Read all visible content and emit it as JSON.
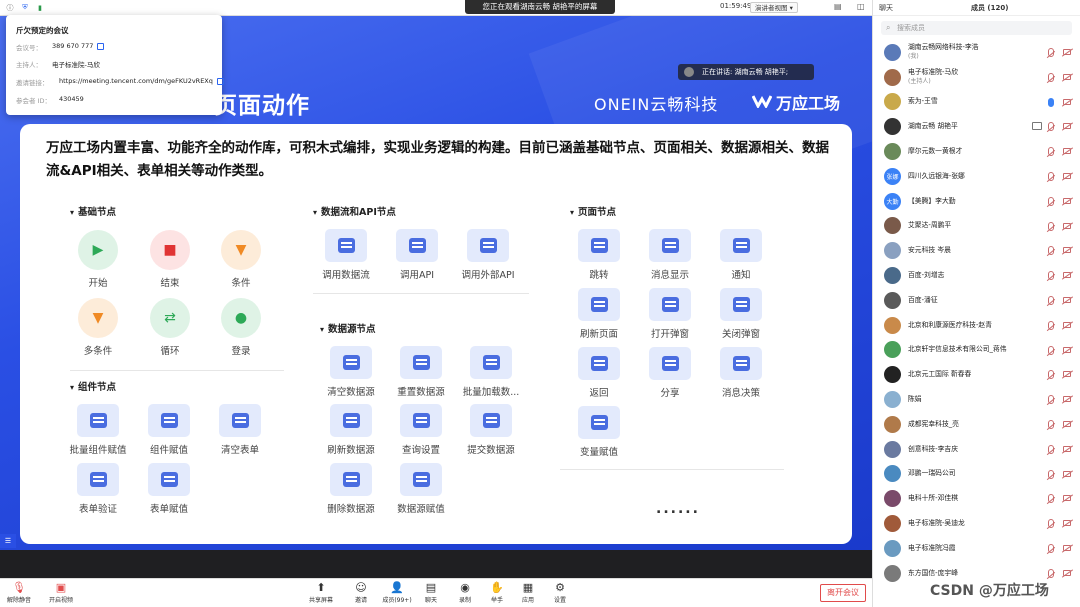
{
  "window": {
    "share_banner": "您正在观看湖南云畅 胡艳平的屏幕",
    "timer": "01:59:49",
    "view_mode": "演讲者视图 ▾"
  },
  "popup": {
    "title": "斤欠预定的会议",
    "rows": [
      {
        "label": "会议号：",
        "value": "389 670 777",
        "copy": true
      },
      {
        "label": "主持人：",
        "value": "电子标准院-马欣",
        "copy": false
      },
      {
        "label": "邀请链接：",
        "value": "https://meeting.tencent.com/dm/geFKU2vREXq",
        "copy": true
      },
      {
        "label": "参会者 ID：",
        "value": "430459",
        "copy": false
      }
    ]
  },
  "slide": {
    "speaker": "正在讲话: 湖南云畅 胡艳平;",
    "title": "页面动作",
    "brand_left": "ONEIN云畅科技",
    "brand_right": "万应工场",
    "intro": "万应工场内置丰富、功能齐全的动作库，可积木式编排，实现业务逻辑的构建。目前已涵盖基础节点、页面相关、数据源相关、数据流&API相关、表单相关等动作类型。",
    "sections": {
      "basic": "基础节点",
      "component": "组件节点",
      "dataflow": "数据流和API节点",
      "datasource": "数据源节点",
      "page": "页面节点"
    },
    "basic_nodes": [
      "开始",
      "结束",
      "条件",
      "多条件",
      "循环",
      "登录"
    ],
    "component_nodes": [
      "批量组件赋值",
      "组件赋值",
      "清空表单",
      "表单验证",
      "表单赋值"
    ],
    "dataflow_nodes": [
      "调用数据流",
      "调用API",
      "调用外部API"
    ],
    "datasource_nodes": [
      "清空数据源",
      "重置数据源",
      "批量加载数...",
      "刷新数据源",
      "查询设置",
      "提交数据源",
      "删除数据源",
      "数据源赋值"
    ],
    "page_nodes": [
      "跳转",
      "消息显示",
      "通知",
      "刷新页面",
      "打开弹窗",
      "关闭弹窗",
      "返回",
      "分享",
      "消息决策",
      "变量赋值"
    ],
    "more": "......"
  },
  "toolbar": {
    "mute": "解除静音",
    "video": "开启视频",
    "share": "共享屏幕",
    "invite": "邀请",
    "members": "成员(99+)",
    "chat": "聊天",
    "record": "录制",
    "raise": "举手",
    "apps": "应用",
    "settings": "设置",
    "leave": "离开会议"
  },
  "right_panel": {
    "tab_chat": "聊天",
    "tab_members": "成员 (120)",
    "search_placeholder": "搜索成员",
    "members": [
      {
        "name": "湖南云畅网络科技-李浩",
        "sub": "(我)",
        "color": "#5a7ab8",
        "text": ""
      },
      {
        "name": "电子标准院-马欣",
        "sub": "(主持人)",
        "color": "#a06a4a",
        "text": ""
      },
      {
        "name": "索为-王雪",
        "sub": "",
        "color": "#c9a94a",
        "text": "",
        "mic_on": true
      },
      {
        "name": "湖南云畅 胡艳平",
        "sub": "",
        "color": "#333333",
        "text": "",
        "screen": true
      },
      {
        "name": "摩尔元数一黄根才",
        "sub": "",
        "color": "#6a8a5a",
        "text": ""
      },
      {
        "name": "四川久远银海-张娜",
        "sub": "",
        "color": "#3b82f6",
        "text": "张娜"
      },
      {
        "name": "【美腾】李大勤",
        "sub": "",
        "color": "#3b82f6",
        "text": "大勤"
      },
      {
        "name": "艾聚达-周鹏平",
        "sub": "",
        "color": "#7a5a4a",
        "text": ""
      },
      {
        "name": "安元科技 岑晨",
        "sub": "",
        "color": "#8aa0c0",
        "text": ""
      },
      {
        "name": "百度-刘增志",
        "sub": "",
        "color": "#4a6a8a",
        "text": ""
      },
      {
        "name": "百度-潘征",
        "sub": "",
        "color": "#5a5a5a",
        "text": ""
      },
      {
        "name": "北京和利康源医疗科技-赵青",
        "sub": "",
        "color": "#c98a4a",
        "text": ""
      },
      {
        "name": "北京轩宇信息技术有限公司_蒋伟",
        "sub": "",
        "color": "#4aa05a",
        "text": ""
      },
      {
        "name": "北京元工国际 靳春春",
        "sub": "",
        "color": "#222222",
        "text": ""
      },
      {
        "name": "陈娟",
        "sub": "",
        "color": "#8ab0d0",
        "text": ""
      },
      {
        "name": "成都宪幸科技_亮",
        "sub": "",
        "color": "#b07a4a",
        "text": ""
      },
      {
        "name": "创意科技-李吉庆",
        "sub": "",
        "color": "#6a7aa0",
        "text": ""
      },
      {
        "name": "邓鹏一瑞码公司",
        "sub": "",
        "color": "#4a8ac0",
        "text": ""
      },
      {
        "name": "电科十所-邓佳棋",
        "sub": "",
        "color": "#7a4a6a",
        "text": ""
      },
      {
        "name": "电子标准院-吴迪龙",
        "sub": "",
        "color": "#a05a3a",
        "text": ""
      },
      {
        "name": "电子标准院冯霞",
        "sub": "",
        "color": "#6a9ac0",
        "text": ""
      },
      {
        "name": "东方国信-庞宇峰",
        "sub": "",
        "color": "#7a7a7a",
        "text": ""
      }
    ]
  },
  "watermark": "CSDN @万应工场"
}
